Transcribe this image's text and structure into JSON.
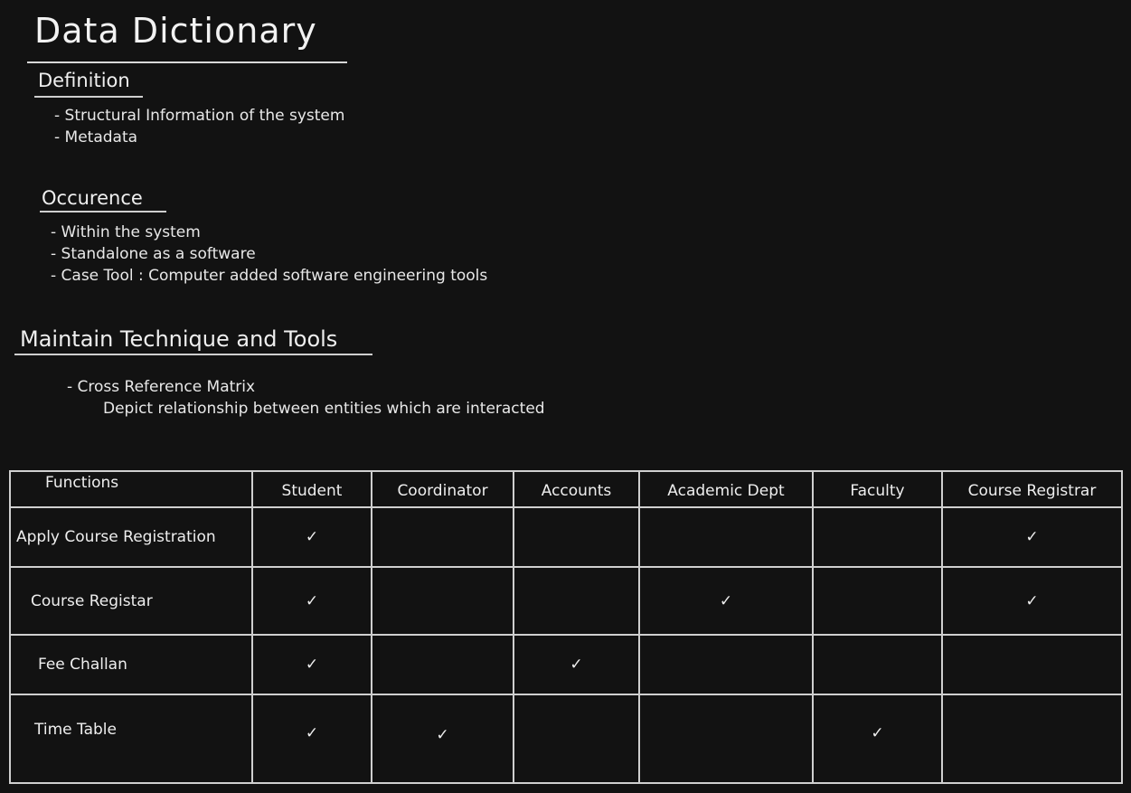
{
  "title": "Data Dictionary",
  "sections": {
    "definition": {
      "heading": "Definition",
      "items": [
        "- Structural Information of the system",
        "- Metadata"
      ]
    },
    "occurence": {
      "heading": "Occurence",
      "items": [
        "- Within the system",
        "- Standalone as a software",
        "- Case Tool : Computer added software engineering tools"
      ]
    },
    "maintain": {
      "heading": "Maintain Technique and Tools",
      "items": [
        "- Cross Reference Matrix",
        "Depict relationship between entities which are interacted"
      ]
    }
  },
  "matrix": {
    "columns": [
      "Functions",
      "Student",
      "Coordinator",
      "Accounts",
      "Academic Dept",
      "Faculty",
      "Course Registrar"
    ],
    "check_glyph": "✓",
    "rows": [
      {
        "function": "Apply Course Registration",
        "cells": [
          "✓",
          "",
          "",
          "",
          "",
          "✓"
        ]
      },
      {
        "function": "Course Registar",
        "cells": [
          "✓",
          "",
          "",
          "✓",
          "",
          "✓"
        ]
      },
      {
        "function": "Fee Challan",
        "cells": [
          "✓",
          "",
          "✓",
          "",
          "",
          ""
        ]
      },
      {
        "function": "Time Table",
        "cells": [
          "✓",
          "✓",
          "",
          "",
          "✓",
          ""
        ]
      }
    ]
  }
}
